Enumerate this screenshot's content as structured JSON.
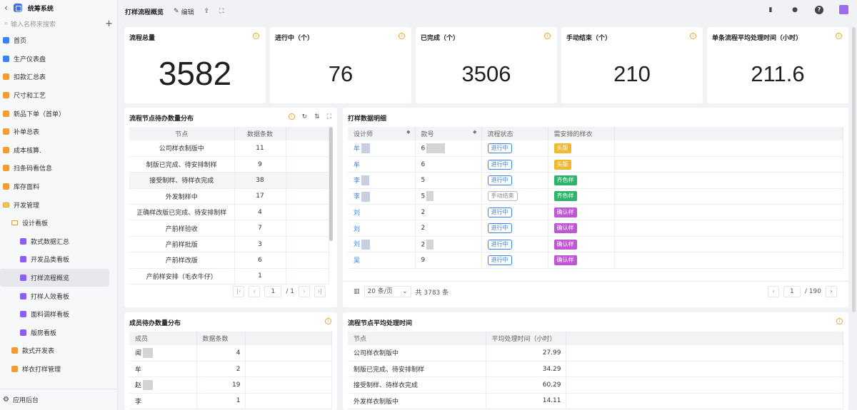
{
  "app": {
    "title": "统筹系统"
  },
  "sidebar": {
    "search_placeholder": "输入名称来搜索",
    "items": [
      {
        "label": "首页",
        "level": 0,
        "icon": "home-icon"
      },
      {
        "label": "生产仪表盘",
        "level": 0,
        "icon": "dashboard-icon"
      },
      {
        "label": "扣款汇总表",
        "level": 0,
        "icon": "table-icon"
      },
      {
        "label": "尺寸和工艺",
        "level": 0,
        "icon": "table-icon"
      },
      {
        "label": "新品下单（首单）",
        "level": 0,
        "icon": "table-icon"
      },
      {
        "label": "补单总表",
        "level": 0,
        "icon": "table-icon"
      },
      {
        "label": "成本核算.",
        "level": 0,
        "icon": "gear-icon"
      },
      {
        "label": "扫条码看信息",
        "level": 0,
        "icon": "table-icon"
      },
      {
        "label": "库存面料",
        "level": 0,
        "icon": "table-icon"
      },
      {
        "label": "开发管理",
        "level": 0,
        "icon": "folder-icon"
      },
      {
        "label": "设计看板",
        "level": 1,
        "icon": "folder-icon"
      },
      {
        "label": "款式数据汇总",
        "level": 2,
        "icon": "chart-icon"
      },
      {
        "label": "开发品类看板",
        "level": 2,
        "icon": "chart-icon"
      },
      {
        "label": "打样流程概览",
        "level": 2,
        "icon": "chart-icon"
      },
      {
        "label": "打样人效看板",
        "level": 2,
        "icon": "chart-icon"
      },
      {
        "label": "面料调样看板",
        "level": 2,
        "icon": "chart-icon"
      },
      {
        "label": "版房看板",
        "level": 2,
        "icon": "chart-icon"
      },
      {
        "label": "款式开发表",
        "level": 1,
        "icon": "table-icon"
      },
      {
        "label": "样衣打样管理",
        "level": 1,
        "icon": "table-icon"
      }
    ],
    "bottom_label": "应用后台"
  },
  "header": {
    "title": "打样流程概览",
    "edit_label": "编辑"
  },
  "stats": [
    {
      "title": "流程总量",
      "value": "3582"
    },
    {
      "title": "进行中（个）",
      "value": "76"
    },
    {
      "title": "已完成（个）",
      "value": "3506"
    },
    {
      "title": "手动结束（个）",
      "value": "210"
    },
    {
      "title": "单条流程平均处理时间（小时）",
      "value": "211.6"
    }
  ],
  "node_pending": {
    "title": "流程节点待办数量分布",
    "columns": [
      "节点",
      "数据条数"
    ],
    "rows": [
      [
        "公司样衣制版中",
        "11"
      ],
      [
        "制版已完成、待安排制样",
        "9"
      ],
      [
        "接受制样、待样衣完成",
        "38"
      ],
      [
        "外发制样中",
        "17"
      ],
      [
        "正确样改版已完成、待安排制样",
        "4"
      ],
      [
        "产前样验收",
        "7"
      ],
      [
        "产前样批版",
        "3"
      ],
      [
        "产前样改版",
        "6"
      ],
      [
        "产前样安排（毛衣牛仔）",
        "1"
      ]
    ],
    "page": "1",
    "page_total": "/ 1"
  },
  "sample_detail": {
    "title": "打样数据明细",
    "columns": [
      "设计师",
      "款号",
      "流程状态",
      "需安排的样衣"
    ],
    "rows": [
      {
        "designer": "牟",
        "code": "6",
        "status": "进行中",
        "sample": "头版",
        "color": "#f2b830"
      },
      {
        "designer": "牟",
        "code": "6",
        "status": "进行中",
        "sample": "头版",
        "color": "#f2b830"
      },
      {
        "designer": "李",
        "code": "5",
        "status": "进行中",
        "sample": "齐色样",
        "color": "#2fb36b"
      },
      {
        "designer": "李",
        "code": "5",
        "status": "手动结束",
        "sample": "齐色样",
        "color": "#2fb36b"
      },
      {
        "designer": "刘",
        "code": "2",
        "status": "进行中",
        "sample": "确认样",
        "color": "#c056d6"
      },
      {
        "designer": "刘",
        "code": "2",
        "status": "进行中",
        "sample": "确认样",
        "color": "#c056d6"
      },
      {
        "designer": "刘",
        "code": "2",
        "status": "进行中",
        "sample": "确认样",
        "color": "#c056d6"
      },
      {
        "designer": "吴",
        "code": "9",
        "status": "进行中",
        "sample": "确认样",
        "color": "#c056d6"
      }
    ],
    "page_size": "20 条/页",
    "total": "共 3783 条",
    "page": "1",
    "page_total": "/ 190"
  },
  "member_pending": {
    "title": "成员待办数量分布",
    "columns": [
      "成员",
      "数据条数"
    ],
    "rows": [
      [
        "闻",
        "4"
      ],
      [
        "牟",
        "2"
      ],
      [
        "赵",
        "19"
      ],
      [
        "李",
        "1"
      ]
    ]
  },
  "node_avg_time": {
    "title": "流程节点平均处理时间",
    "columns": [
      "节点",
      "平均处理时间（小时）"
    ],
    "rows": [
      [
        "公司样衣制版中",
        "27.99"
      ],
      [
        "制版已完成、待安排制样",
        "34.29"
      ],
      [
        "接受制样、待样衣完成",
        "60.29"
      ],
      [
        "外发样衣制版中",
        "14.11"
      ]
    ]
  },
  "colors": {
    "accent": "#3b82f6",
    "warning": "#e8a33d"
  }
}
